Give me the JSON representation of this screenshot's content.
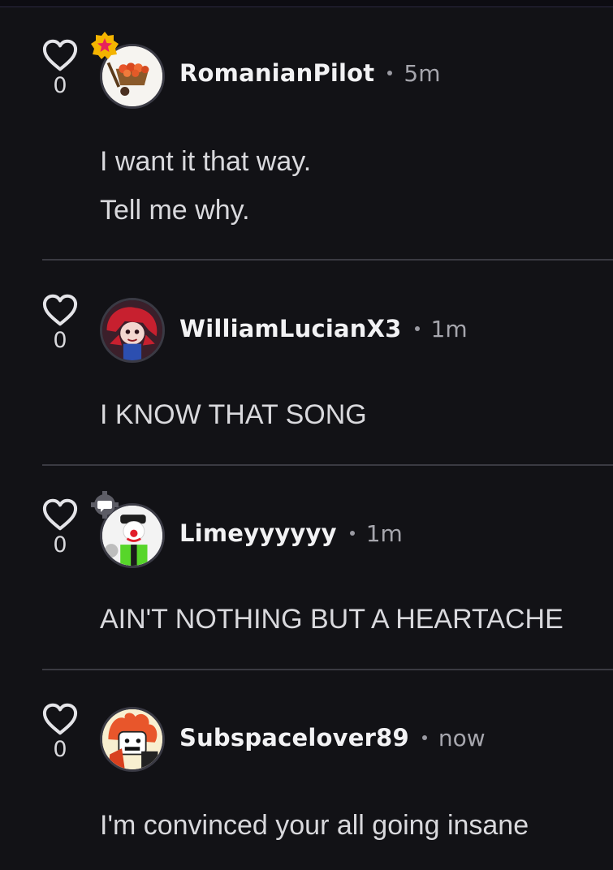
{
  "comments": [
    {
      "username": "RomanianPilot",
      "time": "5m",
      "likes": "0",
      "badge": "star-badge",
      "avatar": "wheelbarrow-avatar",
      "lines": [
        "I want it that way.",
        "Tell me why."
      ]
    },
    {
      "username": "WilliamLucianX3",
      "time": "1m",
      "likes": "0",
      "badge": "",
      "avatar": "red-hair-character-avatar",
      "lines": [
        "I KNOW THAT SONG"
      ]
    },
    {
      "username": "Limeyyyyyy",
      "time": "1m",
      "likes": "0",
      "badge": "gear-badge",
      "avatar": "clown-character-avatar",
      "lines": [
        "AIN'T NOTHING BUT A HEARTACHE"
      ]
    },
    {
      "username": "Subspacelover89",
      "time": "now",
      "likes": "0",
      "badge": "",
      "avatar": "flame-character-avatar",
      "lines": [
        "I'm convinced your all going insane"
      ]
    }
  ],
  "colors": {
    "background": "#121216",
    "divider": "#3a3a42",
    "star_badge": "#f4b400",
    "star": "#e8215b"
  }
}
